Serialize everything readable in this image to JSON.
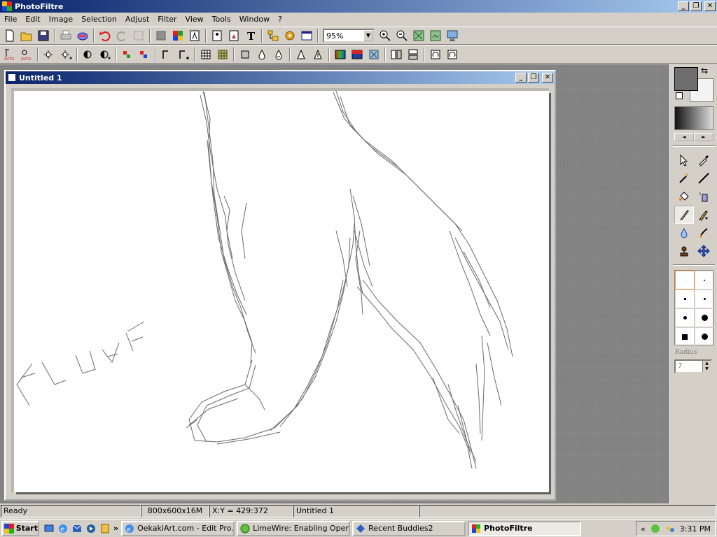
{
  "app": {
    "title": "PhotoFiltre"
  },
  "window_controls": {
    "minimize": "_",
    "restore": "❐",
    "close": "✕"
  },
  "menu": [
    "File",
    "Edit",
    "Image",
    "Selection",
    "Adjust",
    "Filter",
    "View",
    "Tools",
    "Window",
    "?"
  ],
  "toolbar": {
    "zoom_value": "95%"
  },
  "document": {
    "title": "Untitled 1",
    "drawing_text": "FLUFF"
  },
  "palette": {
    "foreground_color": "#6e6e6e",
    "background_color": "#f4f4f4",
    "radius_label": "Radius",
    "radius_value": "7"
  },
  "status": {
    "state": "Ready",
    "size": "800x600x16M",
    "coords": "X:Y = 429:372",
    "doc_name": "Untitled 1"
  },
  "taskbar": {
    "start": "Start",
    "overflow": "»",
    "tasks": [
      {
        "label": "OekakiArt.com - Edit Pro...",
        "icon": "ie-icon"
      },
      {
        "label": "LimeWire: Enabling Open...",
        "icon": "limewire-icon"
      },
      {
        "label": "Recent Buddies2",
        "icon": "buddy-icon"
      },
      {
        "label": "PhotoFiltre",
        "icon": "photofiltre-icon"
      }
    ],
    "tray_arrow": "«",
    "clock": "3:31 PM"
  }
}
